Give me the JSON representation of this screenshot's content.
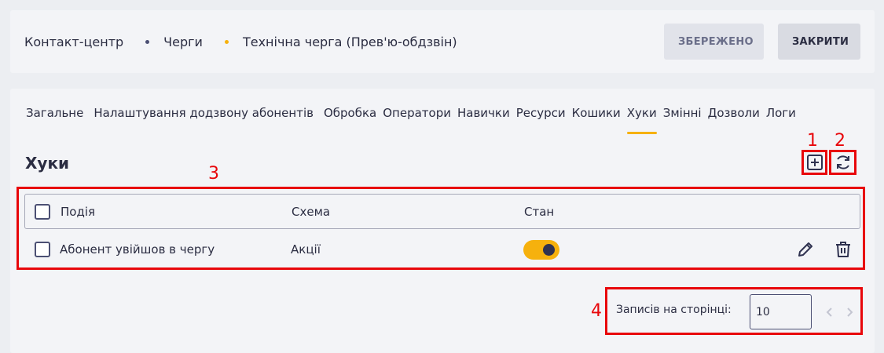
{
  "header": {
    "breadcrumb": [
      "Контакт-центр",
      "Черги",
      "Технічна черга (Прев'ю-обдзвін)"
    ],
    "saved_label": "ЗБЕРЕЖЕНО",
    "close_label": "ЗАКРИТИ"
  },
  "tabs": [
    "Загальне",
    "Налаштування додзвону абонентів",
    "Обробка",
    "Оператори",
    "Навички",
    "Ресурси",
    "Кошики",
    "Хуки",
    "Змінні",
    "Дозволи",
    "Логи"
  ],
  "active_tab": "Хуки",
  "section": {
    "title": "Хуки",
    "add_icon": "plus-square-icon",
    "refresh_icon": "refresh-icon"
  },
  "table": {
    "columns": [
      "Подія",
      "Схема",
      "Стан"
    ],
    "rows": [
      {
        "event": "Абонент увійшов в чергу",
        "scheme": "Акції",
        "enabled": true
      }
    ]
  },
  "pagination": {
    "label": "Записів на сторінці:",
    "per_page": "10"
  },
  "annotations": [
    "1",
    "2",
    "3",
    "4"
  ],
  "colors": {
    "accent": "#f6b10d",
    "annotation": "#e8070b",
    "text": "#2b2d42"
  }
}
